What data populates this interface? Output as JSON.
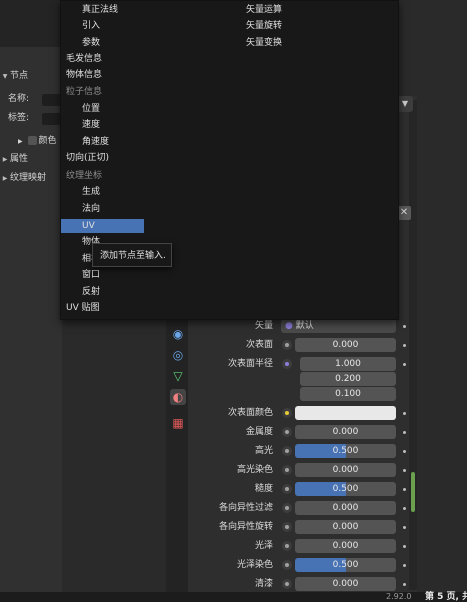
{
  "left_panel": {
    "node_header": "节点",
    "name_label": "名称:",
    "tag_label": "标签:",
    "color_label": "颜色",
    "properties_header": "属性",
    "texture_map_header": "纹理映射"
  },
  "menu": {
    "items_left": [
      {
        "label": "真正法线",
        "style": "sub"
      },
      {
        "label": "引入",
        "style": "sub"
      },
      {
        "label": "参数",
        "style": "sub"
      },
      {
        "label": "毛发信息",
        "style": "top"
      },
      {
        "label": "物体信息",
        "style": "top"
      },
      {
        "label": "粒子信息",
        "style": "head"
      },
      {
        "label": "位置",
        "style": "sub"
      },
      {
        "label": "速度",
        "style": "sub"
      },
      {
        "label": "角速度",
        "style": "sub"
      },
      {
        "label": "切向(正切)",
        "style": "top"
      },
      {
        "label": "纹理坐标",
        "style": "head"
      },
      {
        "label": "生成",
        "style": "sub"
      },
      {
        "label": "法向",
        "style": "sub"
      },
      {
        "label": "UV",
        "style": "sub"
      },
      {
        "label": "物体",
        "style": "sub"
      },
      {
        "label": "相机",
        "style": "sub"
      },
      {
        "label": "窗口",
        "style": "sub"
      },
      {
        "label": "反射",
        "style": "sub"
      },
      {
        "label": "UV 贴图",
        "style": "top"
      }
    ],
    "items_right": [
      "矢量运算",
      "矢量旋转",
      "矢量变换"
    ],
    "highlighted": "UV",
    "tooltip": "添加节点至输入."
  },
  "properties": {
    "rows": [
      {
        "label": "矢量",
        "type": "enum",
        "value": "默认",
        "socket": "purple"
      },
      {
        "label": "次表面",
        "type": "number",
        "value": "0.000",
        "fill": 0
      },
      {
        "label": "次表面半径",
        "type": "vector",
        "values": [
          "1.000",
          "0.200",
          "0.100"
        ],
        "socket": "purple"
      },
      {
        "label": "次表面颜色",
        "type": "color",
        "value": "#e8e8e8",
        "socket": "yellow"
      },
      {
        "label": "金属度",
        "type": "number",
        "value": "0.000",
        "fill": 0
      },
      {
        "label": "高光",
        "type": "number",
        "value": "0.500",
        "fill": 0.5
      },
      {
        "label": "高光染色",
        "type": "number",
        "value": "0.000",
        "fill": 0
      },
      {
        "label": "糙度",
        "type": "number",
        "value": "0.500",
        "fill": 0.5
      },
      {
        "label": "各向异性过滤",
        "type": "number",
        "value": "0.000",
        "fill": 0
      },
      {
        "label": "各向异性旋转",
        "type": "number",
        "value": "0.000",
        "fill": 0
      },
      {
        "label": "光泽",
        "type": "number",
        "value": "0.000",
        "fill": 0
      },
      {
        "label": "光泽染色",
        "type": "number",
        "value": "0.500",
        "fill": 0.5
      },
      {
        "label": "清漆",
        "type": "number",
        "value": "0.000",
        "fill": 0
      }
    ]
  },
  "status": {
    "version": "2.92.0",
    "page": "第 5 页, 共"
  },
  "colors": {
    "accent": "#4772b3",
    "menu_bg": "#181818",
    "socket_yellow": "#e6c93a",
    "socket_purple": "#8c7cd6"
  },
  "icons": [
    "collapse-triangle-icon",
    "node-tree-icon",
    "material-icon",
    "texture-icon",
    "scene-icon",
    "world-icon",
    "close-icon"
  ]
}
